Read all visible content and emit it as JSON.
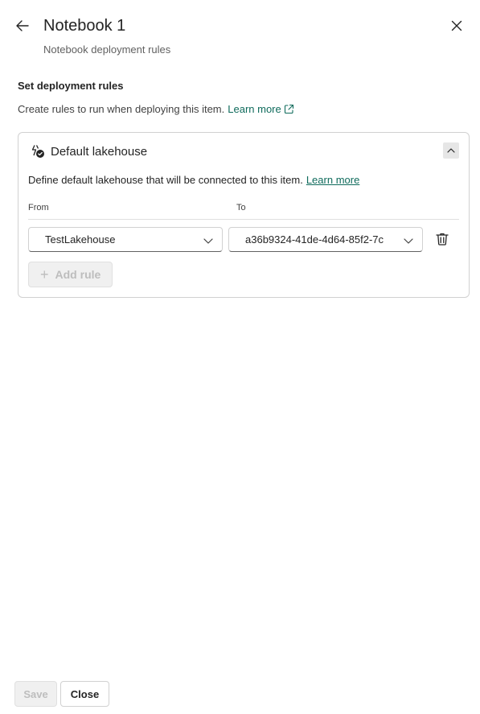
{
  "header": {
    "title": "Notebook 1",
    "subtitle": "Notebook deployment rules"
  },
  "section": {
    "title": "Set deployment rules",
    "description": "Create rules to run when deploying this item.",
    "learn_more": "Learn more"
  },
  "card": {
    "title": "Default lakehouse",
    "description": "Define default lakehouse that will be connected to this item.",
    "learn_more": "Learn more",
    "col_from": "From",
    "col_to": "To",
    "rule": {
      "from_value": "TestLakehouse",
      "to_value": "a36b9324-41de-4d64-85f2-7c"
    },
    "add_rule_label": "Add rule"
  },
  "footer": {
    "save_label": "Save",
    "close_label": "Close"
  },
  "colors": {
    "link": "#0f6b5c",
    "disabled_text": "#bdbdbd",
    "border": "#d1d1d1"
  },
  "icons": [
    "arrow-left-icon",
    "close-icon",
    "external-link-icon",
    "lakehouse-check-icon",
    "chevron-up-icon",
    "chevron-down-icon",
    "trash-icon",
    "plus-icon"
  ]
}
